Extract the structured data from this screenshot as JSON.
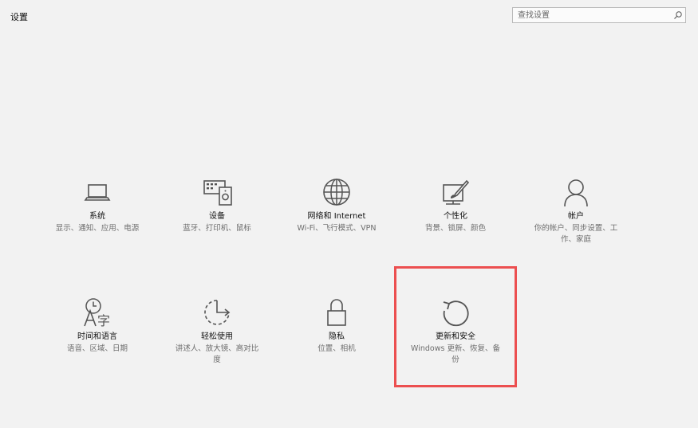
{
  "window": {
    "title": "设置"
  },
  "search": {
    "placeholder": "查找设置"
  },
  "tiles": [
    {
      "label": "系统",
      "desc": "显示、通知、应用、电源",
      "icon": "laptop-icon"
    },
    {
      "label": "设备",
      "desc": "蓝牙、打印机、鼠标",
      "icon": "devices-icon"
    },
    {
      "label": "网络和 Internet",
      "desc": "Wi-Fi、飞行模式、VPN",
      "icon": "globe-icon"
    },
    {
      "label": "个性化",
      "desc": "背景、锁屏、颜色",
      "icon": "personalization-icon"
    },
    {
      "label": "帐户",
      "desc": "你的帐户、同步设置、工作、家庭",
      "icon": "person-icon"
    },
    {
      "label": "时间和语言",
      "desc": "语音、区域、日期",
      "icon": "time-language-icon"
    },
    {
      "label": "轻松使用",
      "desc": "讲述人、放大镜、高对比度",
      "icon": "ease-of-access-icon"
    },
    {
      "label": "隐私",
      "desc": "位置、相机",
      "icon": "lock-icon"
    },
    {
      "label": "更新和安全",
      "desc": "Windows 更新、恢复、备份",
      "icon": "refresh-icon"
    }
  ],
  "colors": {
    "background": "#f2f2f2",
    "icon": "#555555",
    "highlight_border": "#ec4f50"
  }
}
